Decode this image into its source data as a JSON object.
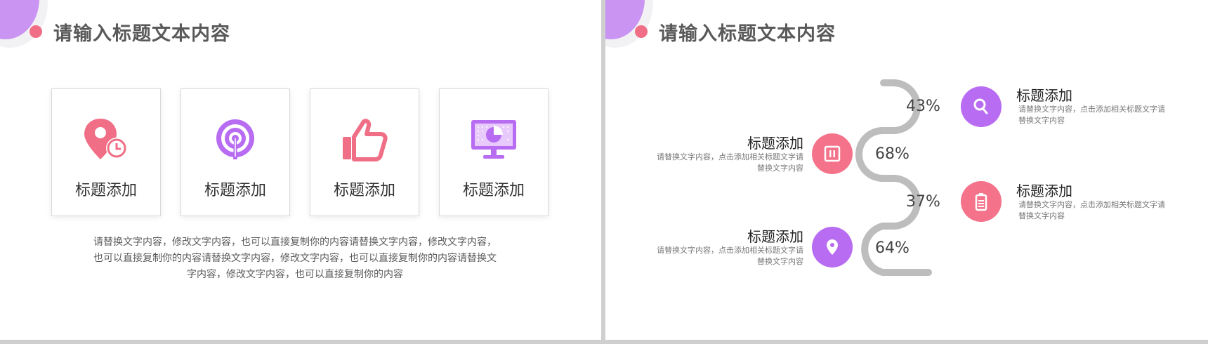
{
  "left_slide": {
    "title": "请输入标题文本内容",
    "cards": [
      {
        "label": "标题添加",
        "icon": "location-clock-icon"
      },
      {
        "label": "标题添加",
        "icon": "signal-broadcast-icon"
      },
      {
        "label": "标题添加",
        "icon": "thumbs-up-icon"
      },
      {
        "label": "标题添加",
        "icon": "monitor-chart-icon"
      }
    ],
    "description": [
      "请替换文字内容，修改文字内容，也可以直接复制你的内容请替换文字内容，修改文字内容，",
      "也可以直接复制你的内容请替换文字内容，修改文字内容，也可以直接复制你的内容请替换文",
      "字内容，修改文字内容，也可以直接复制你的内容"
    ]
  },
  "right_slide": {
    "title": "请输入标题文本内容",
    "items": [
      {
        "percent": "43%",
        "title": "标题添加",
        "desc": "请替换文字内容，点击添加相关标题文字请替换文字内容",
        "icon": "search-icon",
        "color": "#b86cf2"
      },
      {
        "percent": "68%",
        "title": "标题添加",
        "desc": "请替换文字内容，点击添加相关标题文字请替换文字内容",
        "icon": "pause-icon",
        "color": "#f4738a"
      },
      {
        "percent": "37%",
        "title": "标题添加",
        "desc": "请替换文字内容，点击添加相关标题文字请替换文字内容",
        "icon": "battery-icon",
        "color": "#f4738a"
      },
      {
        "percent": "64%",
        "title": "标题添加",
        "desc": "请替换文字内容，点击添加相关标题文字请替换文字内容",
        "icon": "map-pin-icon",
        "color": "#b86cf2"
      }
    ]
  },
  "colors": {
    "pink": "#f06e86",
    "purple": "#b86cf2",
    "path_gray": "#bdbdbd"
  }
}
